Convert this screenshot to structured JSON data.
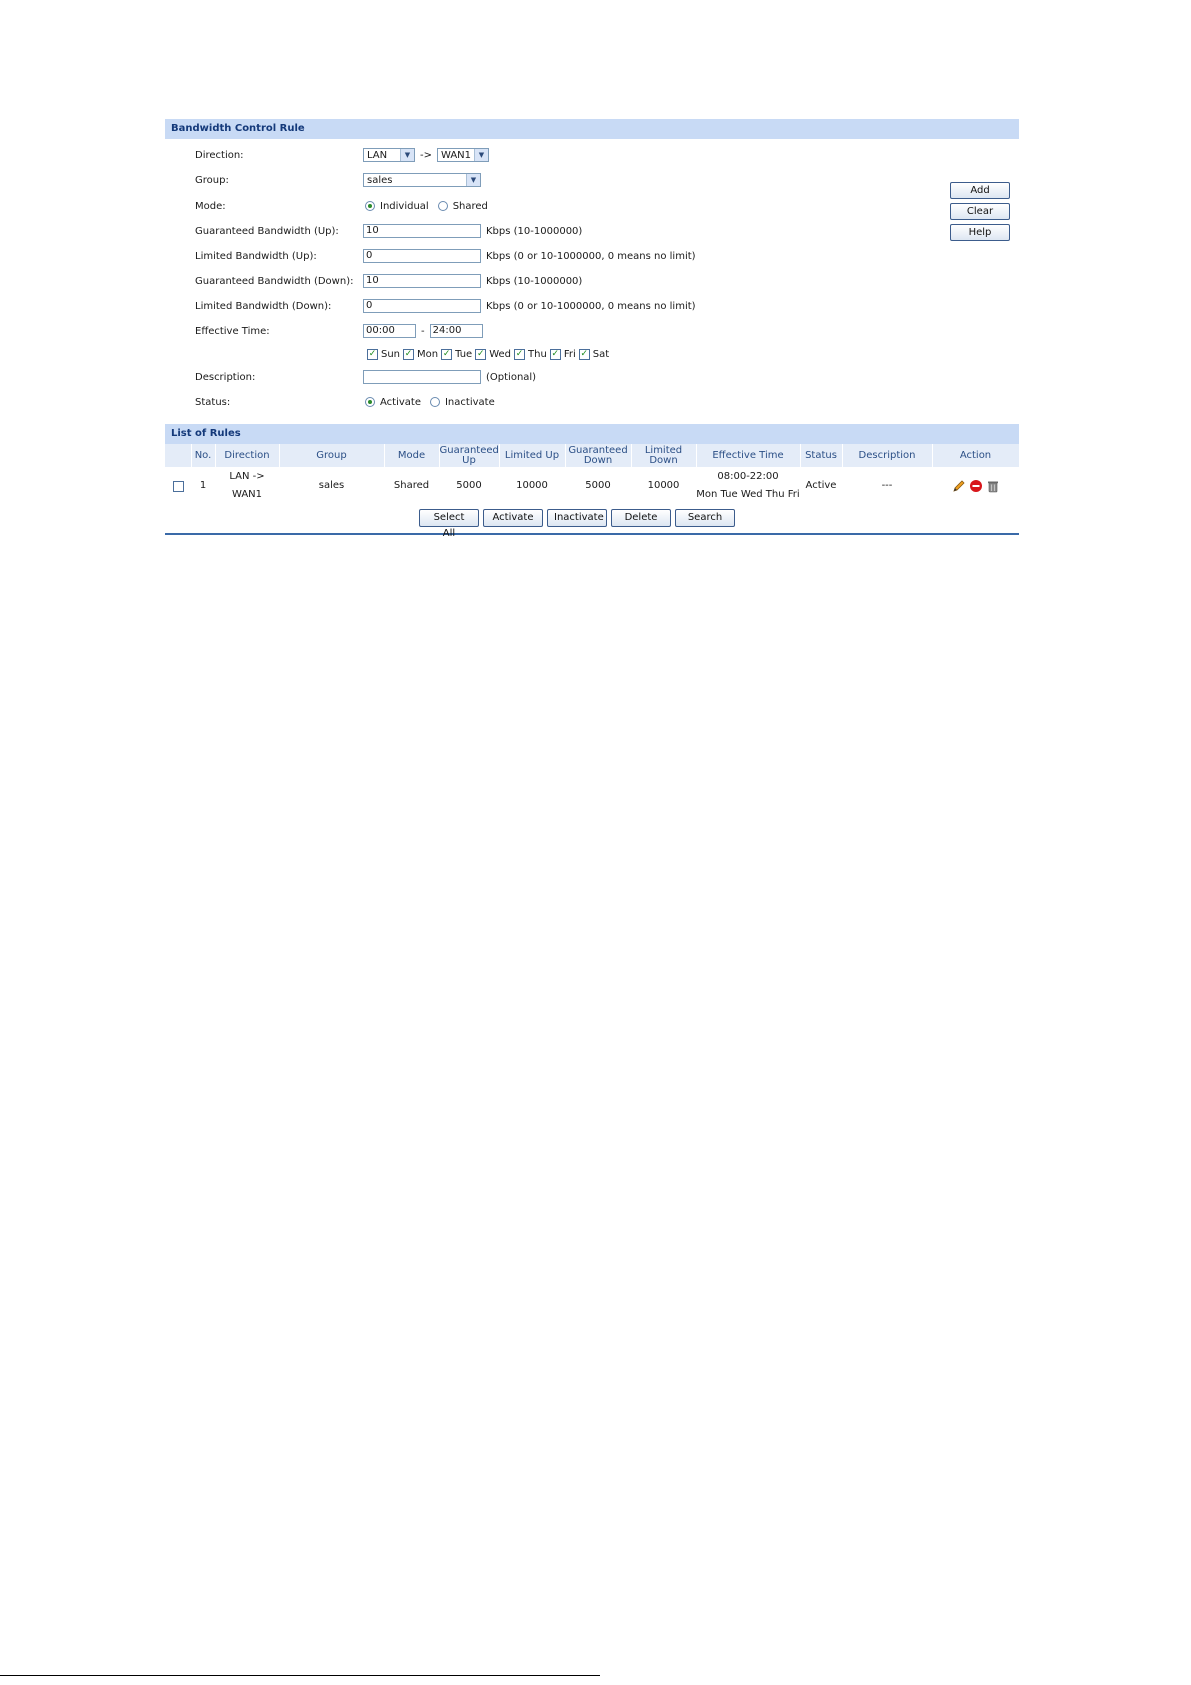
{
  "rule_section": {
    "title": "Bandwidth Control Rule",
    "direction": {
      "label": "Direction:",
      "from": "LAN",
      "sep": "->",
      "to": "WAN1"
    },
    "group": {
      "label": "Group:",
      "value": "sales"
    },
    "mode": {
      "label": "Mode:",
      "opt1": "Individual",
      "opt2": "Shared",
      "selected": "Individual"
    },
    "guar_up": {
      "label": "Guaranteed Bandwidth (Up):",
      "value": "10",
      "hint": "Kbps (10-1000000)"
    },
    "lim_up": {
      "label": "Limited Bandwidth (Up):",
      "value": "0",
      "hint": "Kbps (0 or 10-1000000, 0 means no limit)"
    },
    "guar_down": {
      "label": "Guaranteed Bandwidth (Down):",
      "value": "10",
      "hint": "Kbps (10-1000000)"
    },
    "lim_down": {
      "label": "Limited Bandwidth (Down):",
      "value": "0",
      "hint": "Kbps (0 or 10-1000000, 0 means no limit)"
    },
    "time": {
      "label": "Effective Time:",
      "start": "00:00",
      "sep": "-",
      "end": "24:00"
    },
    "days": [
      "Sun",
      "Mon",
      "Tue",
      "Wed",
      "Thu",
      "Fri",
      "Sat"
    ],
    "description": {
      "label": "Description:",
      "value": "",
      "hint": "(Optional)"
    },
    "status": {
      "label": "Status:",
      "opt1": "Activate",
      "opt2": "Inactivate",
      "selected": "Activate"
    },
    "buttons": {
      "add": "Add",
      "clear": "Clear",
      "help": "Help"
    }
  },
  "list_section": {
    "title": "List of Rules",
    "columns": {
      "no": "No.",
      "direction": "Direction",
      "group": "Group",
      "mode": "Mode",
      "guar_up": "Guaranteed Up",
      "lim_up": "Limited Up",
      "guar_down": "Guaranteed Down",
      "lim_down": "Limited Down",
      "time": "Effective Time",
      "status": "Status",
      "description": "Description",
      "action": "Action"
    },
    "rows": [
      {
        "no": "1",
        "direction_line1": "LAN ->",
        "direction_line2": "WAN1",
        "group": "sales",
        "mode": "Shared",
        "guar_up": "5000",
        "lim_up": "10000",
        "guar_down": "5000",
        "lim_down": "10000",
        "time_line1": "08:00-22:00",
        "time_line2": "Mon Tue Wed Thu Fri",
        "status": "Active",
        "description": "---"
      }
    ],
    "buttons": {
      "select_all": "Select All",
      "activate": "Activate",
      "inactivate": "Inactivate",
      "delete": "Delete",
      "search": "Search"
    }
  },
  "colors": {
    "header_bg": "#c8daf5",
    "header_text": "#14397a",
    "accent_line": "#3a6aa8"
  },
  "icons": [
    "edit-icon",
    "disable-icon",
    "delete-icon",
    "checkbox-icon",
    "dropdown-arrow-icon"
  ]
}
